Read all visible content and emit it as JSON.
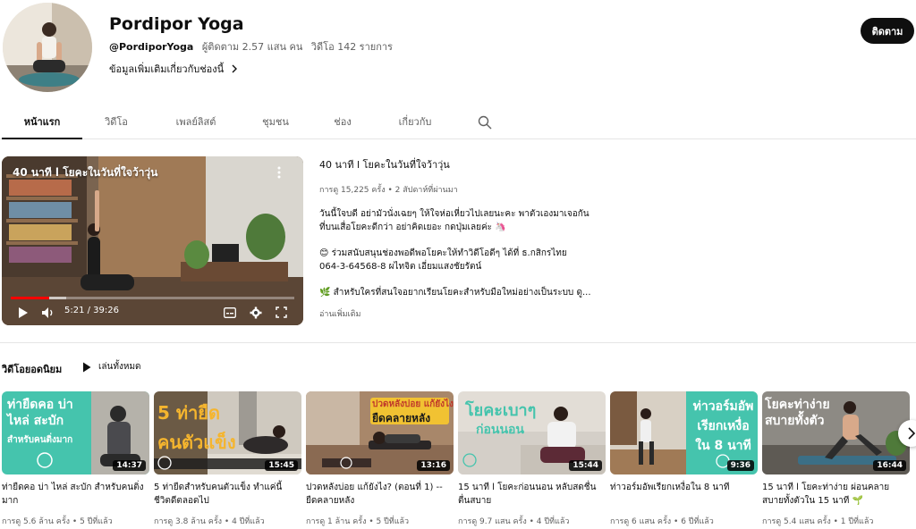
{
  "channel": {
    "name": "Pordipor Yoga",
    "handle": "@PordiporYoga",
    "subscribers": "ผู้ติดตาม 2.57 แสน คน",
    "videos": "วิดีโอ 142 รายการ",
    "more_info": "ข้อมูลเพิ่มเติมเกี่ยวกับช่องนี้",
    "subscribe_label": "ติดตาม"
  },
  "tabs": [
    "หน้าแรก",
    "วิดีโอ",
    "เพลย์ลิสต์",
    "ชุมชน",
    "ช่อง",
    "เกี่ยวกับ"
  ],
  "featured": {
    "overlay_title": "40 นาที l โยคะในวันที่ใจว้าวุ่น",
    "title": "40 นาที l โยคะในวันที่ใจว้าวุ่น",
    "stats": "การดู 15,225 ครั้ง • 2 สัปดาห์ที่ผ่านมา",
    "time": "5:21 / 39:26",
    "progress": 0.136,
    "desc1": "วันนี้ใจบดี อย่ามัวนั่งเฉยๆ ให้ใจห่อเหี่ยวไปเลยนะคะ พาตัวเองมาเจอกัน",
    "desc2": "ที่บนเสื่อโยคะดีกว่า อย่าคิดเยอะ กดปุ่มเลยค่ะ 🦄",
    "desc3": "😊 ร่วมสนับสนุนช่องพอดีพอโยคะให้ทำวิดีโอดีๆ ได้ที่ ธ.กสิกรไทย",
    "desc4": "064-3-64568-8 ผไทจิต เอี่ยมแสงชัยรัตน์",
    "desc5": "🌿 สำหรับใครที่สนใจอยากเรียนโยคะสำหรับมือใหม่อย่างเป็นระบบ ดู...",
    "read_more": "อ่านเพิ่มเติม"
  },
  "popular": {
    "title": "วิดีโอยอดนิยม",
    "play_all": "เล่นทั้งหมด",
    "videos": [
      {
        "overlay": "ท่ายืดคอ บ่า ไหล่ สะบัก",
        "overlay2": "สำหรับคนติ่งมาก",
        "duration": "14:37",
        "title": "ท่ายืดคอ บ่า ไหล่ สะบัก สำหรับคนติ่งมาก",
        "meta": "การดู 5.6 ล้าน ครั้ง • 5 ปีที่แล้ว"
      },
      {
        "overlay": "5 ท่ายืด",
        "overlay2": "คนตัวแข็ง",
        "duration": "15:45",
        "title": "5 ท่ายืดสำหรับคนตัวแข็ง ทำแค่นี้ชีวิตดีตลอดไป",
        "meta": "การดู 3.8 ล้าน ครั้ง • 4 ปีที่แล้ว"
      },
      {
        "overlay": "ปวดหลังบ่อย แก้ยังไง?",
        "overlay2": "ยืดคลายหลัง",
        "duration": "13:16",
        "title": "ปวดหลังบ่อย แก้ยังไง? (ตอนที่ 1) -- ยืดคลายหลัง",
        "meta": "การดู 1 ล้าน ครั้ง • 5 ปีที่แล้ว"
      },
      {
        "overlay": "โยคะเบาๆ",
        "overlay2": "ก่อนนอน",
        "duration": "15:44",
        "title": "15 นาที l โยคะก่อนนอน หลับสดชื่นตื่นสบาย",
        "meta": "การดู 9.7 แสน ครั้ง • 4 ปีที่แล้ว"
      },
      {
        "overlay": "ท่าวอร์มอัพ เรียกเหงื่อ",
        "overlay2": "ใน 8 นาที",
        "duration": "9:36",
        "title": "ท่าวอร์มอัพเรียกเหงื่อใน 8 นาที",
        "meta": "การดู 6 แสน ครั้ง • 6 ปีที่แล้ว"
      },
      {
        "overlay": "โยคะท่าง่าย",
        "overlay2": "สบายทั้งตัว",
        "duration": "16:44",
        "title": "15 นาที l โยคะท่าง่าย ผ่อนคลายสบายทั้งตัวใน 15 นาที 🌱",
        "meta": "การดู 5.4 แสน ครั้ง • 1 ปีที่แล้ว"
      }
    ]
  },
  "colors": {
    "accent_red": "#ff0000",
    "teal": "#45c4ad"
  }
}
